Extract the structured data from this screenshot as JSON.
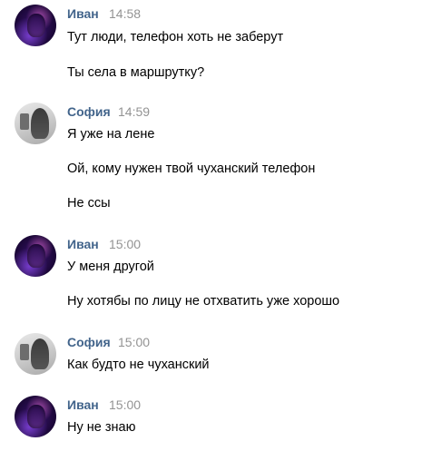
{
  "messages": [
    {
      "author": "Иван",
      "time": "14:58",
      "avatar_icon": "user-avatar-photo-purple",
      "lines": [
        "Тут люди, телефон хоть не заберут",
        "Ты села в маршрутку?"
      ]
    },
    {
      "author": "София",
      "time": "14:59",
      "avatar_icon": "user-avatar-photo-grey",
      "lines": [
        "Я уже на лене",
        "Ой, кому нужен твой чуханский телефон",
        "Не ссы"
      ]
    },
    {
      "author": "Иван",
      "time": "15:00",
      "avatar_icon": "user-avatar-photo-purple",
      "lines": [
        "У меня другой",
        "Ну хотябы по лицу не отхватить уже хорошо"
      ]
    },
    {
      "author": "София",
      "time": "15:00",
      "avatar_icon": "user-avatar-photo-grey",
      "lines": [
        "Как будто не чуханский"
      ]
    },
    {
      "author": "Иван",
      "time": "15:00",
      "avatar_icon": "user-avatar-photo-purple",
      "lines": [
        "Ну не знаю"
      ]
    }
  ],
  "colors": {
    "author_name": "#42648b",
    "timestamp": "#939393",
    "message_text": "#000000",
    "background": "#ffffff"
  }
}
